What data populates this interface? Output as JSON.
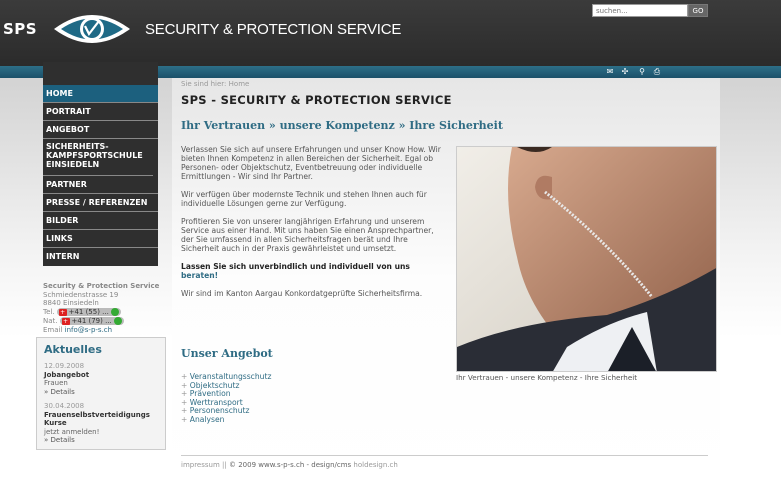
{
  "header": {
    "logo_text": "SPS",
    "site_title": "SECURITY & PROTECTION SERVICE",
    "search_placeholder": "suchen...",
    "search_button": "GO"
  },
  "nav": {
    "items": [
      {
        "label": "HOME",
        "active": true
      },
      {
        "label": "PORTRAIT"
      },
      {
        "label": "ANGEBOT"
      },
      {
        "label": "SICHERHEITS- KAMPFSPORTSCHULE EINSIEDELN"
      },
      {
        "label": "PARTNER"
      },
      {
        "label": "PRESSE / REFERENZEN"
      },
      {
        "label": "BILDER"
      },
      {
        "label": "LINKS"
      },
      {
        "label": "INTERN"
      }
    ]
  },
  "contact": {
    "company": "Security & Protection Service",
    "street": "Schmiedenstrasse 19",
    "city": "8840 Einsiedeln",
    "tel_label": "Tel.",
    "tel_value": "+41 (55) ...",
    "nat_label": "Nat.",
    "nat_value": "+41 (79) ...",
    "email_label": "Email",
    "email_value": "info@s-p-s.ch"
  },
  "news": {
    "heading": "Aktuelles",
    "items": [
      {
        "date": "12.09.2008",
        "title": "Jobangebot",
        "text": "Frauen",
        "link": "» Details"
      },
      {
        "date": "30.04.2008",
        "title": "Frauenselbstverteidigungs Kurse",
        "text": "jetzt anmelden!",
        "link": "» Details"
      }
    ]
  },
  "main": {
    "breadcrumb": "Sie sind hier: Home",
    "title": "SPS - SECURITY & PROTECTION SERVICE",
    "subtitle": "Ihr Vertrauen » unsere Kompetenz » Ihre Sicherheit",
    "p1": "Verlassen Sie sich auf unsere Erfahrungen und unser Know How. Wir bieten Ihnen Kompetenz in allen Bereichen der Sicherheit. Egal ob Personen- oder Objektschutz, Eventbetreuung oder individuelle Ermittlungen - Wir sind Ihr Partner.",
    "p2": "Wir verfügen über modernste Technik und stehen Ihnen auch für individuelle Lösungen gerne zur Verfügung.",
    "p3": "Profitieren Sie von unserer langjährigen Erfahrung und unserem Service aus einer Hand. Mit uns haben Sie einen Ansprechpartner, der Sie umfassend in allen Sicherheitsfragen berät und Ihre Sicherheit auch in der Praxis gewährleistet und umsetzt.",
    "p4_strong": "Lassen Sie sich unverbindlich und individuell von uns",
    "p4_link": "beraten!",
    "p5": "Wir sind im Kanton Aargau Konkordatgeprüfte Sicherheitsfirma.",
    "angebot_title": "Unser Angebot",
    "angebot": [
      "Veranstaltungsschutz",
      "Objektschutz",
      "Prävention",
      "Werttransport",
      "Personenschutz",
      "Analysen"
    ],
    "photo_caption": "Ihr Vertrauen - unsere Kompetenz - Ihre Sicherheit"
  },
  "footer": {
    "impressum": "impressum",
    "sep": "||",
    "copyright": "© 2009 www.s-p-s.ch - design/cms",
    "designer": "holdesign.ch"
  },
  "colors": {
    "accent": "#2f6c84",
    "header": "#333333",
    "nav_active": "#1c607e"
  },
  "icons": [
    "mail-icon",
    "sitemap-icon",
    "search-icon",
    "print-icon"
  ]
}
